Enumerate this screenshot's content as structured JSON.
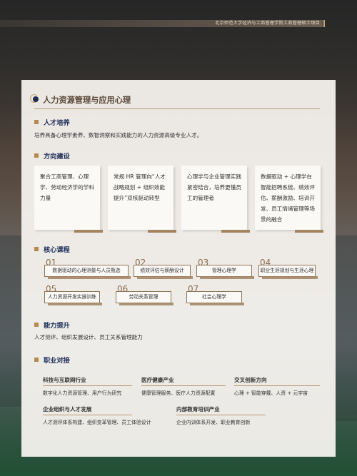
{
  "header_bar": {
    "text": "北京师范大学经济与工商管理学院工商管理硕士项目"
  },
  "card": {
    "title": "人力资源管理与应用心理",
    "sections": {
      "training": {
        "heading": "人才培养",
        "text": "培养具备心理学素养、数智洞察和实践能力的人力资源高级专业人才。"
      },
      "direction": {
        "heading": "方向建设",
        "boxes": [
          "聚合工商管理、心理学、劳动经济学的学科力量",
          "常规 HR 管理向“人才战略规划 + 组织效能提升”双核驱动转型",
          "心理学与企业管理实践紧密结合，培养更懂员工的管理者",
          "数据驱动 + 心理学在智能招聘系统、绩效评估、薪酬激励、培训开发、员工情绪管理等场景的融合"
        ]
      },
      "courses": {
        "heading": "核心课程",
        "items": [
          {
            "num": "01",
            "name": "数据驱动的心理测量与人员甄选"
          },
          {
            "num": "02",
            "name": "绩效评估与薪酬设计"
          },
          {
            "num": "03",
            "name": "管理心理学"
          },
          {
            "num": "04",
            "name": "职业生涯规划与生涯心理"
          },
          {
            "num": "05",
            "name": "人力资源开发实操训练"
          },
          {
            "num": "06",
            "name": "劳动关系管理"
          },
          {
            "num": "07",
            "name": "社会心理学"
          }
        ]
      },
      "ability": {
        "heading": "能力提升",
        "text": "人才测评、组织发展设计、员工关系管理能力"
      },
      "career": {
        "heading": "职业对接",
        "items": [
          {
            "title": "科技与互联网行业",
            "desc": "数字化人力资源管理、用户行为研究"
          },
          {
            "title": "医疗健康产业",
            "desc": "健康管理服务、医疗人力资源配置"
          },
          {
            "title": "交叉创新方向",
            "desc": "心理 + 智能穿戴、人资 + 元宇宙"
          },
          {
            "title": "企业组织与人才发展",
            "desc": "人才测评体系构建、组织变革管理、员工体验设计"
          },
          {
            "title": "内部教育培训产业",
            "desc": "企业内训体系开发、职业教育创新"
          }
        ]
      }
    }
  }
}
